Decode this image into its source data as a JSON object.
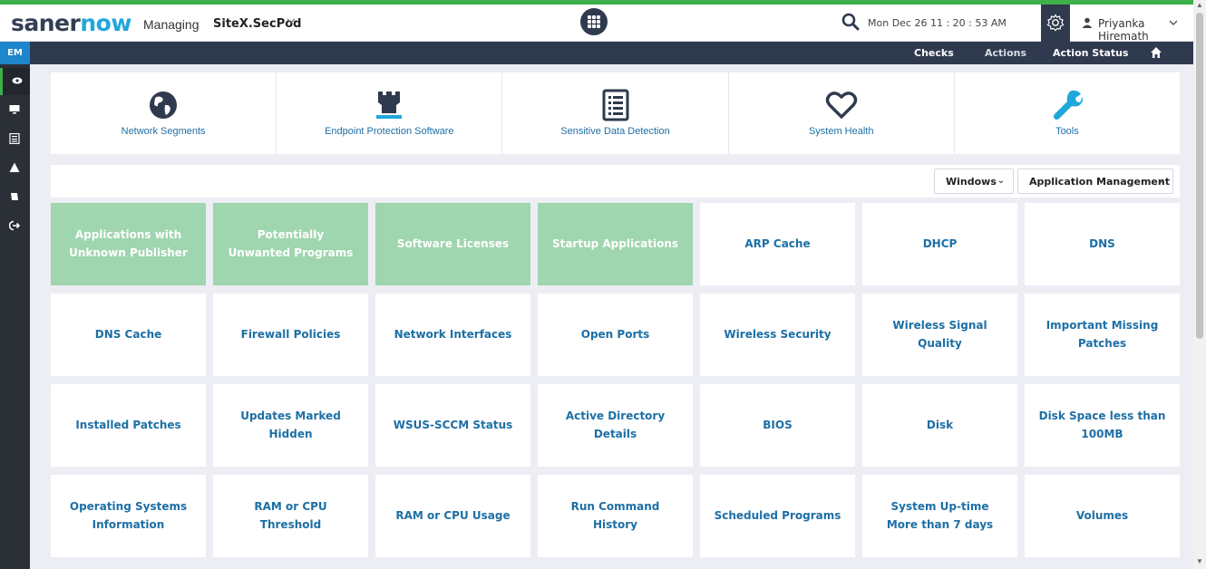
{
  "header": {
    "logo_part1": "saner",
    "logo_part2": "now",
    "managing_label": "Managing",
    "site_name": "SiteX.SecPod",
    "datetime": "Mon Dec 26  11 : 20 : 53 AM",
    "username": "Priyanka Hiremath"
  },
  "sidebar": {
    "badge": "EM",
    "items": [
      "eye-icon",
      "monitor-icon",
      "report-icon",
      "alert-icon",
      "tag-icon",
      "logout-icon"
    ]
  },
  "navbar": {
    "checks": "Checks",
    "actions": "Actions",
    "action_status": "Action Status"
  },
  "categories": [
    {
      "label": "Network Segments",
      "icon": "globe-icon"
    },
    {
      "label": "Endpoint Protection Software",
      "icon": "castle-icon"
    },
    {
      "label": "Sensitive Data Detection",
      "icon": "list-doc-icon"
    },
    {
      "label": "System Health",
      "icon": "heart-icon"
    },
    {
      "label": "Tools",
      "icon": "wrench-icon"
    }
  ],
  "filters": {
    "os": "Windows",
    "category": "Application Management"
  },
  "tiles": [
    {
      "label": "Applications with Unknown Publisher",
      "selected": true
    },
    {
      "label": "Potentially Unwanted Programs",
      "selected": true
    },
    {
      "label": "Software Licenses",
      "selected": true
    },
    {
      "label": "Startup Applications",
      "selected": true
    },
    {
      "label": "ARP Cache",
      "selected": false
    },
    {
      "label": "DHCP",
      "selected": false
    },
    {
      "label": "DNS",
      "selected": false
    },
    {
      "label": "DNS Cache",
      "selected": false
    },
    {
      "label": "Firewall Policies",
      "selected": false
    },
    {
      "label": "Network Interfaces",
      "selected": false
    },
    {
      "label": "Open Ports",
      "selected": false
    },
    {
      "label": "Wireless Security",
      "selected": false
    },
    {
      "label": "Wireless Signal Quality",
      "selected": false
    },
    {
      "label": "Important Missing Patches",
      "selected": false
    },
    {
      "label": "Installed Patches",
      "selected": false
    },
    {
      "label": "Updates Marked Hidden",
      "selected": false
    },
    {
      "label": "WSUS-SCCM Status",
      "selected": false
    },
    {
      "label": "Active Directory Details",
      "selected": false
    },
    {
      "label": "BIOS",
      "selected": false
    },
    {
      "label": "Disk",
      "selected": false
    },
    {
      "label": "Disk Space less than 100MB",
      "selected": false
    },
    {
      "label": "Operating Systems Information",
      "selected": false
    },
    {
      "label": "RAM or CPU Threshold",
      "selected": false
    },
    {
      "label": "RAM or CPU Usage",
      "selected": false
    },
    {
      "label": "Run Command History",
      "selected": false
    },
    {
      "label": "Scheduled Programs",
      "selected": false
    },
    {
      "label": "System Up-time More than 7 days",
      "selected": false
    },
    {
      "label": "Volumes",
      "selected": false
    }
  ],
  "colors": {
    "accent_green": "#3cb04a",
    "brand_blue": "#20a7dc",
    "navy": "#2f3a4f",
    "tile_selected": "#9fd5af",
    "link_blue": "#1d6fa5"
  }
}
